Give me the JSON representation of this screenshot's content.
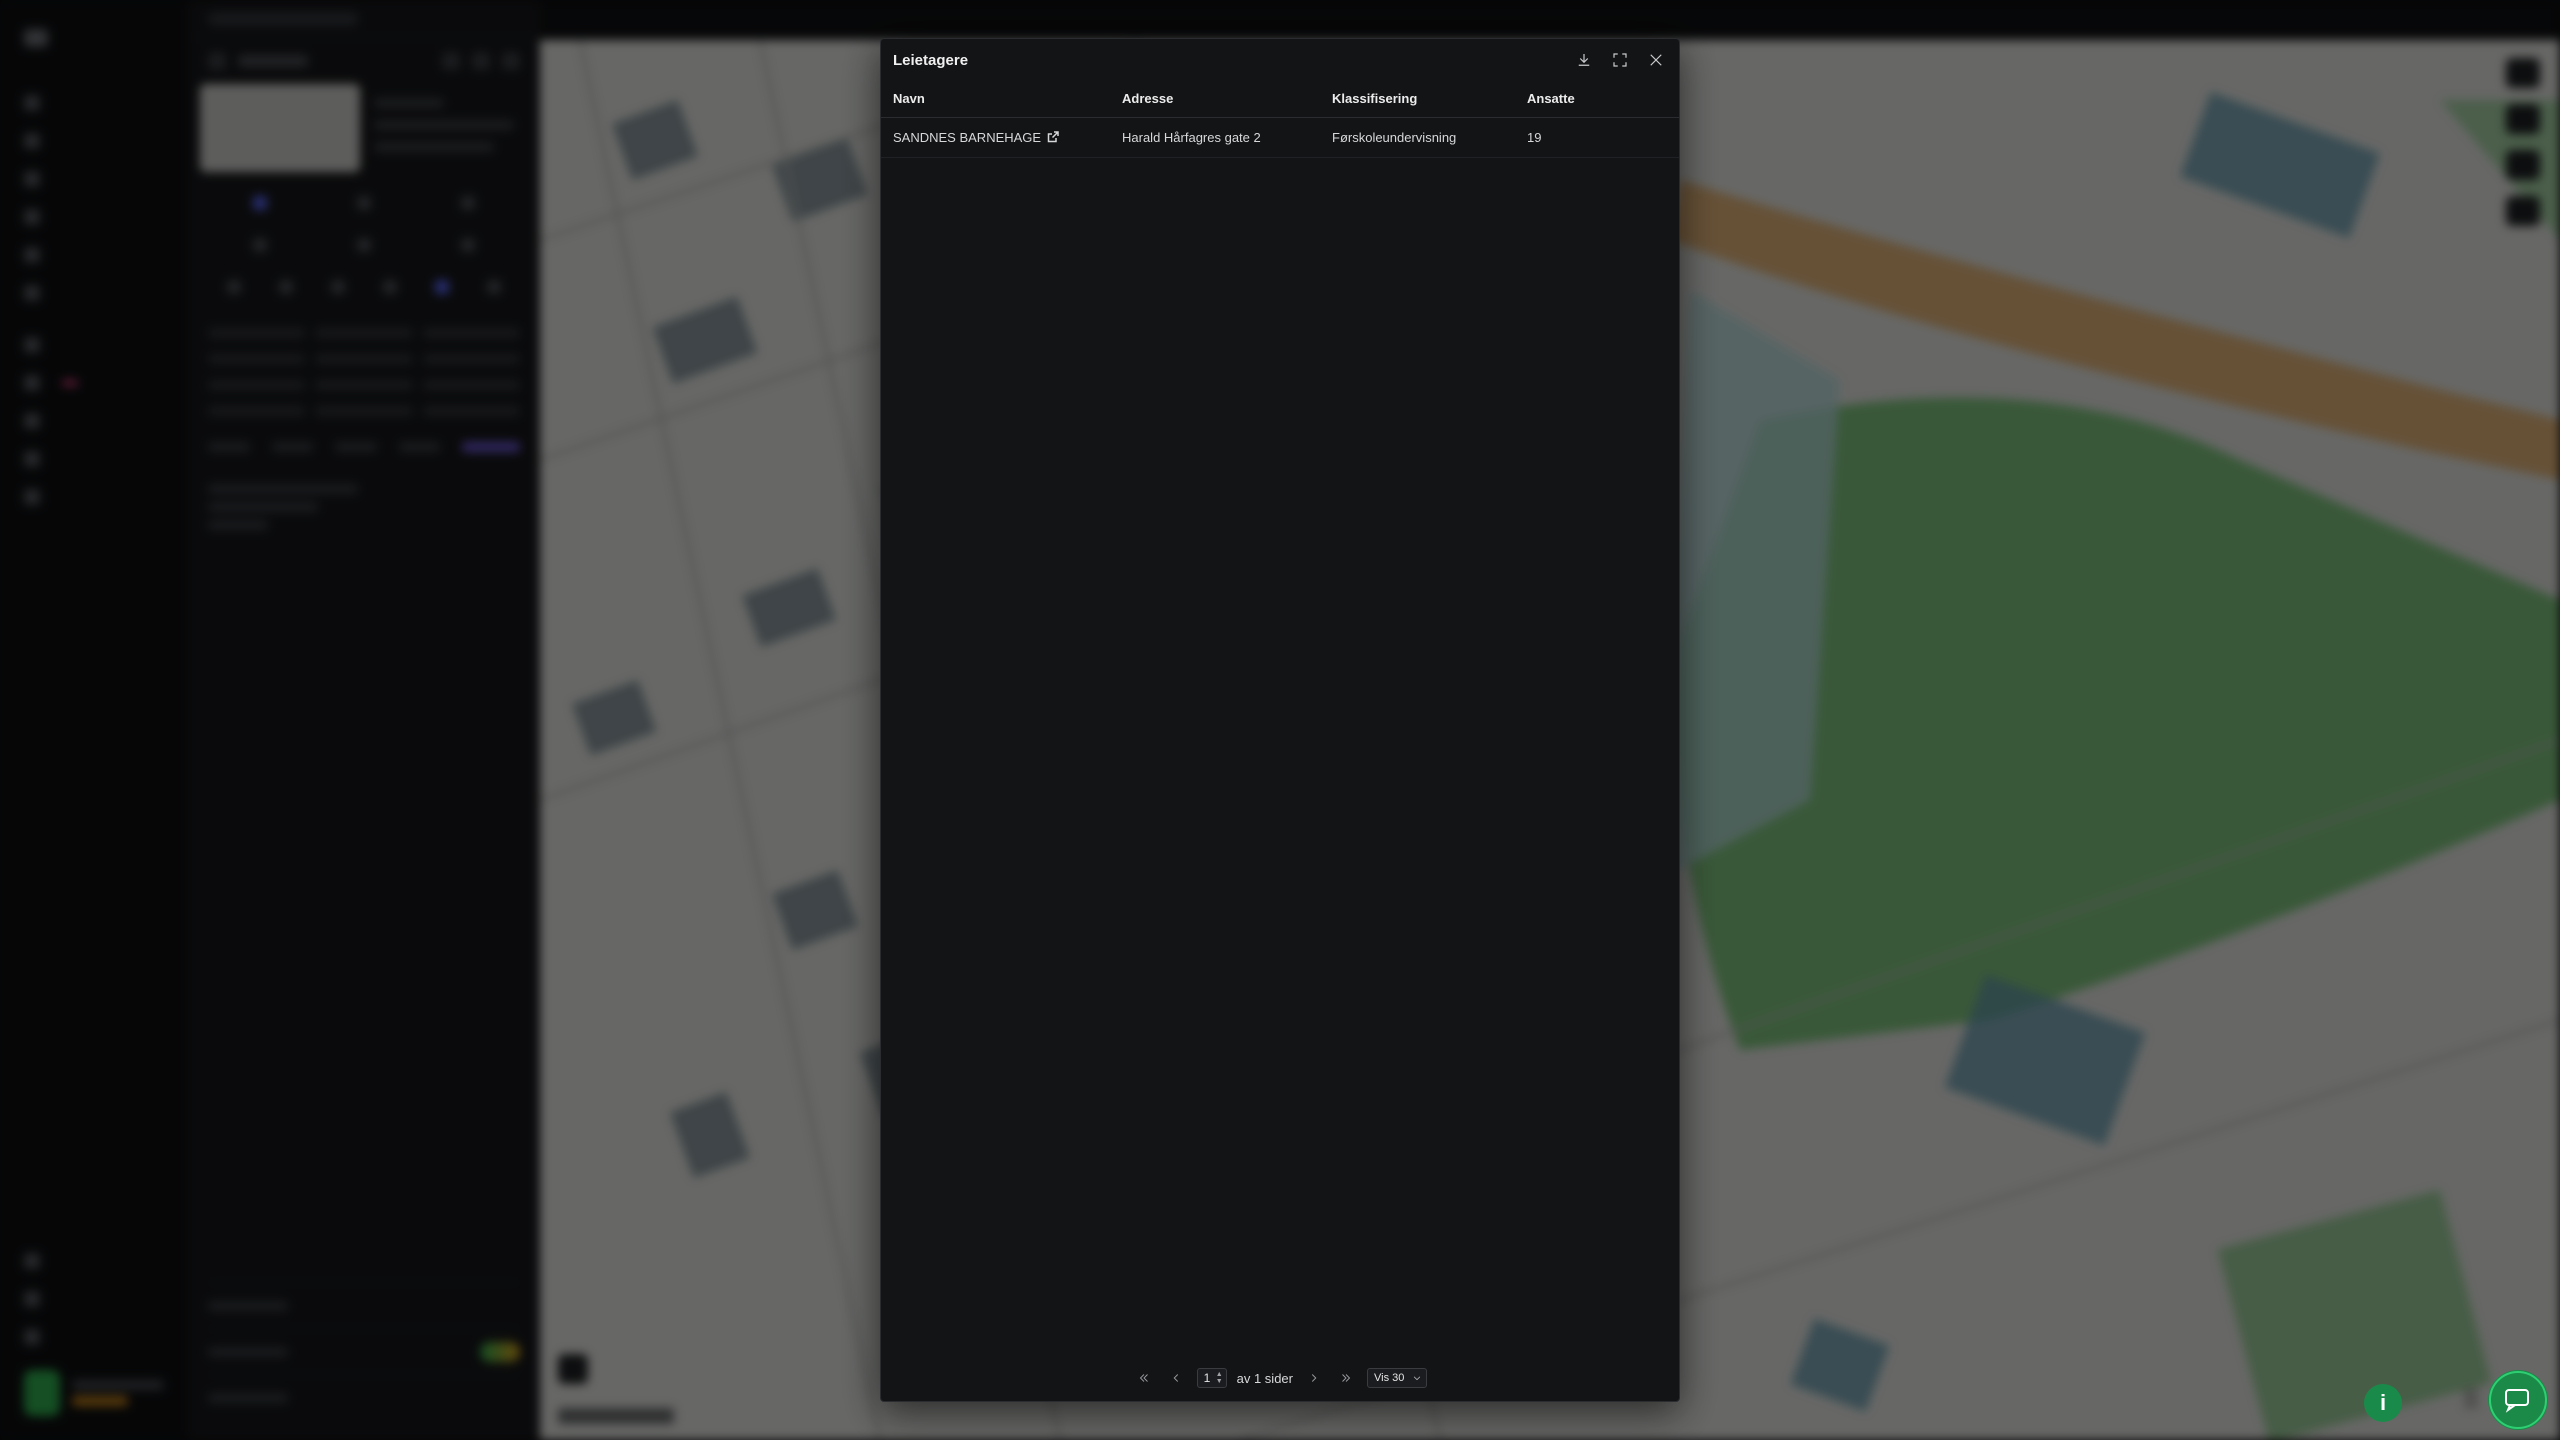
{
  "modal": {
    "title": "Leietagere",
    "columns": [
      "Navn",
      "Adresse",
      "Klassifisering",
      "Ansatte"
    ],
    "rows": [
      {
        "navn": "SANDNES BARNEHAGE",
        "adresse": "Harald Hårfagres gate 2",
        "klassifisering": "Førskoleundervisning",
        "ansatte": "19"
      }
    ],
    "pagination": {
      "page": "1",
      "of_label": "av 1 sider",
      "page_size": "Vis 30"
    },
    "icons": {
      "download": "download-icon",
      "expand": "expand-icon",
      "close": "close-icon",
      "external_link": "external-link-icon",
      "first": "chevrons-left-icon",
      "prev": "chevron-left-icon",
      "next": "chevron-right-icon",
      "last": "chevrons-right-icon"
    }
  },
  "background": {
    "info_label": "i"
  },
  "colors": {
    "modal_bg": "#131416",
    "accent_green": "#1b8a48",
    "badge_pink": "#e0437f"
  }
}
